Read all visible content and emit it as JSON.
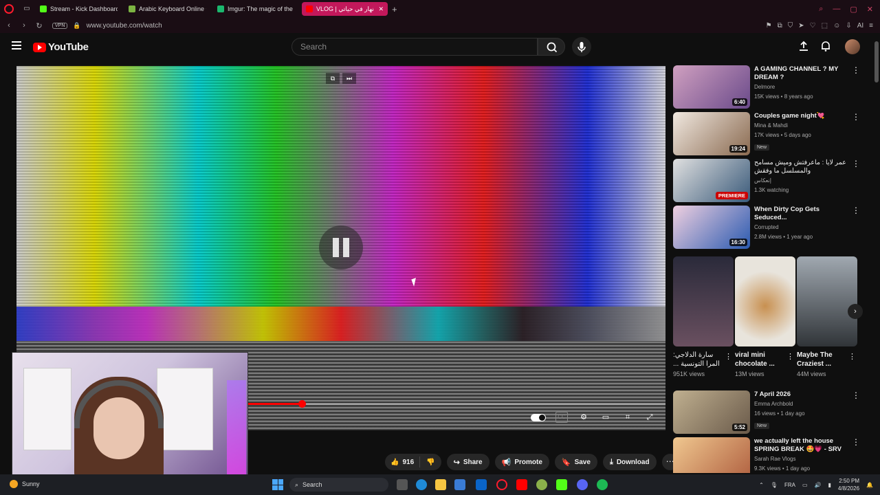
{
  "browser": {
    "tabs": [
      {
        "title": "Stream - Kick Dashboard",
        "color": "#53fc18"
      },
      {
        "title": "Arabic Keyboard Online •",
        "color": "#7cb342"
      },
      {
        "title": "Imgur: The magic of the In",
        "color": "#1bb76e"
      },
      {
        "title": "VLOG | نهار في حياتي 😝",
        "color": "#ff0000",
        "active": true
      }
    ],
    "url": "www.youtube.com/watch",
    "vpn_label": "VPN",
    "new_tab": "+",
    "ai_label": "AI"
  },
  "youtube": {
    "logo_text": "YouTube",
    "search_placeholder": "Search"
  },
  "player": {
    "progress": 0.44,
    "buffered": 0.62
  },
  "actions": {
    "like_count": "916",
    "share": "Share",
    "promote": "Promote",
    "save": "Save",
    "download": "Download"
  },
  "recommendations": [
    {
      "title": "A GAMING CHANNEL ? MY DREAM ?",
      "channel": "Delmore",
      "stats": "15K views • 8 years ago",
      "duration": "6:40",
      "thumb_color": "#8a6aa8"
    },
    {
      "title": "Couples game night💘",
      "channel": "Mina & Mahdi",
      "stats": "17K views • 5 days ago",
      "duration": "19:24",
      "badge": "New",
      "thumb_color": "#c9b8a6"
    },
    {
      "title": "عمر لايا : ماعرفتش وميش مسامح والمسلسل ما وفقش",
      "channel": "إنعكاس",
      "stats": "1.3K watching",
      "premiere": "PREMIERE",
      "thumb_color": "#4a6a8a"
    },
    {
      "title": "When Dirty Cop Gets Seduced...",
      "channel": "Corrupted",
      "stats": "2.8M views • 1 year ago",
      "duration": "16:30",
      "thumb_color": "#3a6ab0"
    },
    {
      "title": "7 April 2026",
      "channel": "Emma Archbold",
      "stats": "16 views • 1 day ago",
      "duration": "5:52",
      "badge": "New",
      "thumb_color": "#9a8a70"
    },
    {
      "title": "we actually left the house SPRING BREAK 🤩💗 - SRV ...",
      "channel": "Sarah Rae Vlogs",
      "stats": "9.3K views • 1 day ago",
      "duration": "",
      "thumb_color": "#d8a070"
    }
  ],
  "shorts": [
    {
      "title": "سارة الدلاجي: المرا التونسية ...",
      "views": "951K views",
      "thumb_color": "#3a3040"
    },
    {
      "title": "viral mini chocolate ...",
      "views": "13M views",
      "thumb_color": "#e8e4dc"
    },
    {
      "title": "Maybe The Craziest ...",
      "views": "44M views",
      "thumb_color": "#555a60"
    }
  ],
  "taskbar": {
    "weather": "Sunny",
    "search": "Search",
    "language": "FRA",
    "time": "2:50 PM",
    "date": "4/8/2026"
  }
}
